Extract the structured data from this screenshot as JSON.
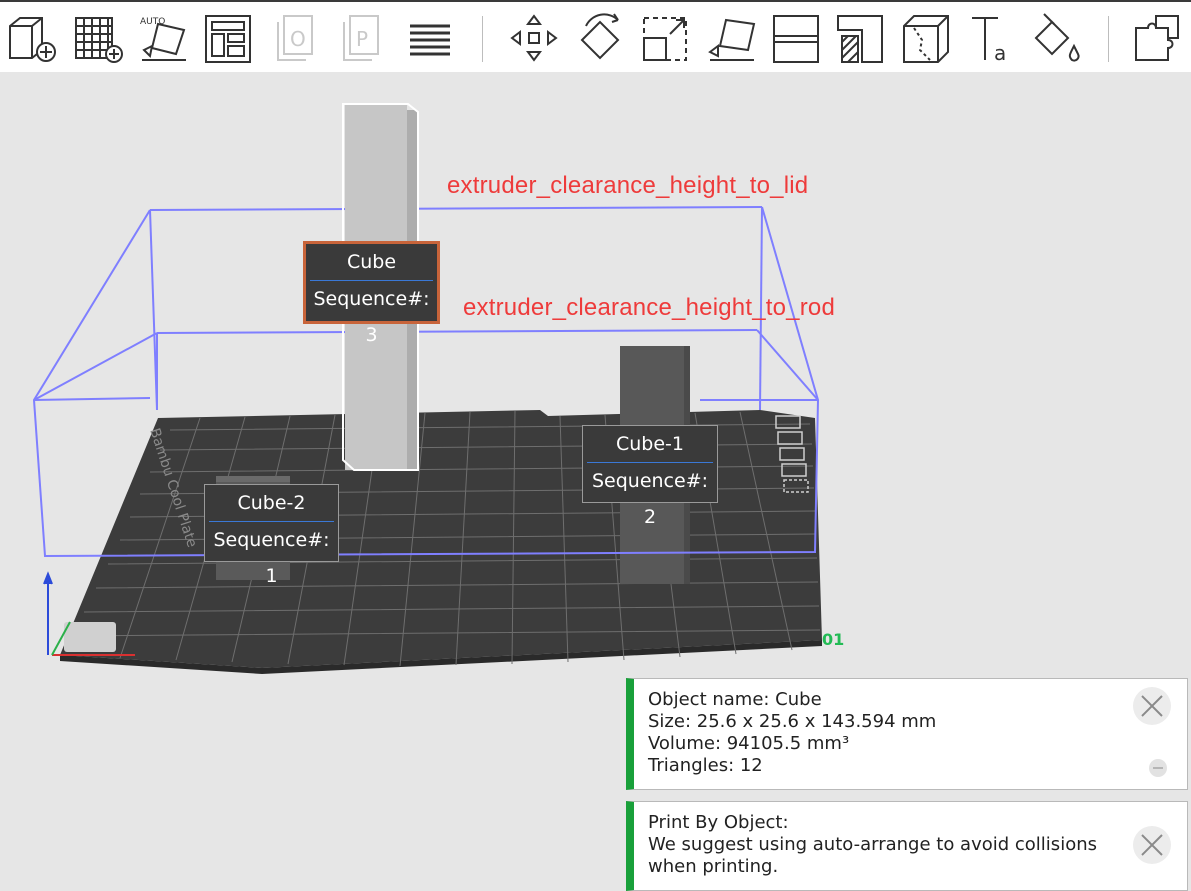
{
  "toolbar": {
    "icons": [
      {
        "name": "add-object-icon"
      },
      {
        "name": "add-plate-icon"
      },
      {
        "name": "auto-orient-icon",
        "badge": "AUTO"
      },
      {
        "name": "arrange-icon"
      },
      {
        "name": "plate-o-icon",
        "badge": "O"
      },
      {
        "name": "plate-p-icon",
        "badge": "P"
      },
      {
        "name": "layers-icon"
      },
      {
        "name": "move-icon"
      },
      {
        "name": "rotate-icon"
      },
      {
        "name": "scale-icon"
      },
      {
        "name": "lay-on-face-icon"
      },
      {
        "name": "cut-icon"
      },
      {
        "name": "support-paint-icon"
      },
      {
        "name": "seam-paint-icon"
      },
      {
        "name": "text-icon",
        "badge": "Ta"
      },
      {
        "name": "color-paint-icon"
      },
      {
        "name": "assembly-icon"
      }
    ]
  },
  "annotations": {
    "lid": "extruder_clearance_height_to_lid",
    "rod": "extruder_clearance_height_to_rod"
  },
  "objects": [
    {
      "name": "Cube",
      "sequence": "Sequence#: 3",
      "selected": true
    },
    {
      "name": "Cube-1",
      "sequence": "Sequence#: 2",
      "selected": false
    },
    {
      "name": "Cube-2",
      "sequence": "Sequence#: 1",
      "selected": false
    }
  ],
  "plate": {
    "label": "Bambu Cool Plate",
    "number": "01"
  },
  "notifications": [
    {
      "lines": [
        "Object name: Cube",
        "Size: 25.6 x 25.6 x 143.594 mm",
        "Volume: 94105.5 mm³",
        "Triangles: 12"
      ]
    },
    {
      "lines": [
        "Print By Object:",
        "We suggest using auto-arrange to avoid collisions",
        "when printing."
      ]
    }
  ],
  "colors": {
    "accent": "#19a03a",
    "annotation": "#ee3b3b",
    "selection": "#c8643a",
    "volume": "#7f7fff"
  }
}
